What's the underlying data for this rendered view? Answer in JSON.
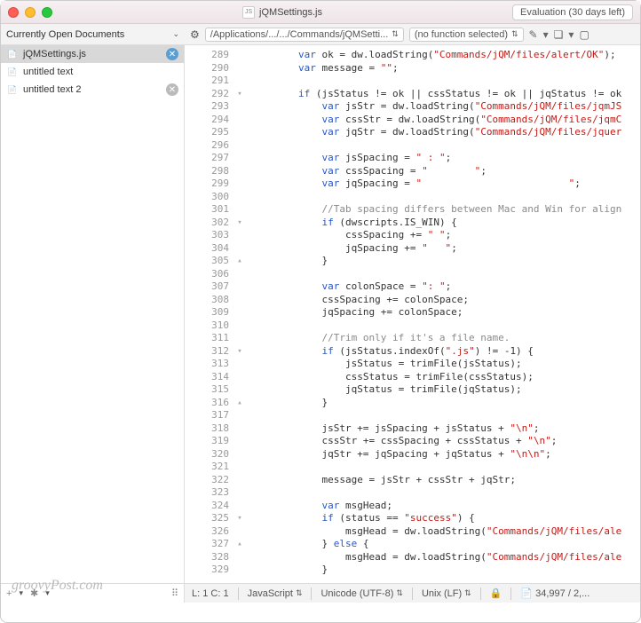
{
  "titlebar": {
    "filename": "jQMSettings.js",
    "eval": "Evaluation (30 days left)"
  },
  "filesHeader": "Currently Open Documents",
  "files": [
    {
      "name": "jQMSettings.js",
      "selected": true,
      "closeStyle": "blue"
    },
    {
      "name": "untitled text",
      "selected": false,
      "closeStyle": "none"
    },
    {
      "name": "untitled text 2",
      "selected": false,
      "closeStyle": "grey"
    }
  ],
  "toolbar": {
    "path": "/Applications/.../.../Commands/jQMSetti...",
    "funcSel": "(no function selected)"
  },
  "watermark": "groovyPost.com",
  "status": {
    "pos": "L: 1 C: 1",
    "lang": "JavaScript",
    "enc": "Unicode (UTF-8)",
    "lineend": "Unix (LF)",
    "size": "34,997 / 2,..."
  },
  "lineStart": 289,
  "lineCount": 41,
  "folds": {
    "292": "▾",
    "302": "▾",
    "305": "▴",
    "312": "▾",
    "316": "▴",
    "325": "▾",
    "327": "▴"
  },
  "code": [
    {
      "i": "        ",
      "t": [
        [
          "kw",
          "var"
        ],
        [
          "",
          " ok = dw.loadString("
        ],
        [
          "str",
          "\"Commands/jQM/files/alert/OK\""
        ],
        [
          "",
          ");"
        ]
      ]
    },
    {
      "i": "        ",
      "t": [
        [
          "kw",
          "var"
        ],
        [
          "",
          " message = "
        ],
        [
          "str",
          "\"\""
        ],
        [
          "",
          ";"
        ]
      ]
    },
    {
      "i": "        ",
      "t": [
        [
          "",
          ""
        ]
      ]
    },
    {
      "i": "        ",
      "t": [
        [
          "kw",
          "if"
        ],
        [
          "",
          " (jsStatus != ok || cssStatus != ok || jqStatus != ok"
        ]
      ]
    },
    {
      "i": "            ",
      "t": [
        [
          "kw",
          "var"
        ],
        [
          "",
          " jsStr = dw.loadString("
        ],
        [
          "str",
          "\"Commands/jQM/files/jqmJS"
        ]
      ]
    },
    {
      "i": "            ",
      "t": [
        [
          "kw",
          "var"
        ],
        [
          "",
          " cssStr = dw.loadString("
        ],
        [
          "str",
          "\"Commands/jQM/files/jqmC"
        ]
      ]
    },
    {
      "i": "            ",
      "t": [
        [
          "kw",
          "var"
        ],
        [
          "",
          " jqStr = dw.loadString("
        ],
        [
          "str",
          "\"Commands/jQM/files/jquer"
        ]
      ]
    },
    {
      "i": "            ",
      "t": [
        [
          "",
          ""
        ]
      ]
    },
    {
      "i": "            ",
      "t": [
        [
          "kw",
          "var"
        ],
        [
          "",
          " jsSpacing = "
        ],
        [
          "str",
          "\" : \""
        ],
        [
          "",
          ";"
        ]
      ]
    },
    {
      "i": "            ",
      "t": [
        [
          "kw",
          "var"
        ],
        [
          "",
          " cssSpacing = "
        ],
        [
          "str",
          "\"        \""
        ],
        [
          "",
          ";"
        ]
      ]
    },
    {
      "i": "            ",
      "t": [
        [
          "kw",
          "var"
        ],
        [
          "",
          " jqSpacing = "
        ],
        [
          "str",
          "\"                         \""
        ],
        [
          "",
          ";"
        ]
      ]
    },
    {
      "i": "            ",
      "t": [
        [
          "",
          ""
        ]
      ]
    },
    {
      "i": "            ",
      "t": [
        [
          "cm",
          "//Tab spacing differs between Mac and Win for align"
        ]
      ]
    },
    {
      "i": "            ",
      "t": [
        [
          "kw",
          "if"
        ],
        [
          "",
          " (dwscripts.IS_WIN) {"
        ]
      ]
    },
    {
      "i": "                ",
      "t": [
        [
          "",
          "cssSpacing += "
        ],
        [
          "str",
          "\" \""
        ],
        [
          "",
          ";"
        ]
      ]
    },
    {
      "i": "                ",
      "t": [
        [
          "",
          "jqSpacing += "
        ],
        [
          "str",
          "\"   \""
        ],
        [
          "",
          ";"
        ]
      ]
    },
    {
      "i": "            ",
      "t": [
        [
          "",
          "}"
        ]
      ]
    },
    {
      "i": "            ",
      "t": [
        [
          "",
          ""
        ]
      ]
    },
    {
      "i": "            ",
      "t": [
        [
          "kw",
          "var"
        ],
        [
          "",
          " colonSpace = "
        ],
        [
          "str",
          "\": \""
        ],
        [
          "",
          ";"
        ]
      ]
    },
    {
      "i": "            ",
      "t": [
        [
          "",
          "cssSpacing += colonSpace;"
        ]
      ]
    },
    {
      "i": "            ",
      "t": [
        [
          "",
          "jqSpacing += colonSpace;"
        ]
      ]
    },
    {
      "i": "            ",
      "t": [
        [
          "",
          ""
        ]
      ]
    },
    {
      "i": "            ",
      "t": [
        [
          "cm",
          "//Trim only if it's a file name."
        ]
      ]
    },
    {
      "i": "            ",
      "t": [
        [
          "kw",
          "if"
        ],
        [
          "",
          " (jsStatus.indexOf("
        ],
        [
          "str",
          "\".js\""
        ],
        [
          "",
          ") != -1) {"
        ]
      ]
    },
    {
      "i": "                ",
      "t": [
        [
          "",
          "jsStatus = trimFile(jsStatus);"
        ]
      ]
    },
    {
      "i": "                ",
      "t": [
        [
          "",
          "cssStatus = trimFile(cssStatus);"
        ]
      ]
    },
    {
      "i": "                ",
      "t": [
        [
          "",
          "jqStatus = trimFile(jqStatus);"
        ]
      ]
    },
    {
      "i": "            ",
      "t": [
        [
          "",
          "}"
        ]
      ]
    },
    {
      "i": "            ",
      "t": [
        [
          "",
          ""
        ]
      ]
    },
    {
      "i": "            ",
      "t": [
        [
          "",
          "jsStr += jsSpacing + jsStatus + "
        ],
        [
          "str",
          "\"\\n\""
        ],
        [
          "",
          ";"
        ]
      ]
    },
    {
      "i": "            ",
      "t": [
        [
          "",
          "cssStr += cssSpacing + cssStatus + "
        ],
        [
          "str",
          "\"\\n\""
        ],
        [
          "",
          ";"
        ]
      ]
    },
    {
      "i": "            ",
      "t": [
        [
          "",
          "jqStr += jqSpacing + jqStatus + "
        ],
        [
          "str",
          "\"\\n\\n\""
        ],
        [
          "",
          ";"
        ]
      ]
    },
    {
      "i": "            ",
      "t": [
        [
          "",
          ""
        ]
      ]
    },
    {
      "i": "            ",
      "t": [
        [
          "",
          "message = jsStr + cssStr + jqStr;"
        ]
      ]
    },
    {
      "i": "            ",
      "t": [
        [
          "",
          ""
        ]
      ]
    },
    {
      "i": "            ",
      "t": [
        [
          "kw",
          "var"
        ],
        [
          "",
          " msgHead;"
        ]
      ]
    },
    {
      "i": "            ",
      "t": [
        [
          "kw",
          "if"
        ],
        [
          "",
          " (status == "
        ],
        [
          "str",
          "\"success\""
        ],
        [
          "",
          ") {"
        ]
      ]
    },
    {
      "i": "                ",
      "t": [
        [
          "",
          "msgHead = dw.loadString("
        ],
        [
          "str",
          "\"Commands/jQM/files/ale"
        ]
      ]
    },
    {
      "i": "            ",
      "t": [
        [
          "",
          "} "
        ],
        [
          "kw",
          "else"
        ],
        [
          "",
          " {"
        ]
      ]
    },
    {
      "i": "                ",
      "t": [
        [
          "",
          "msgHead = dw.loadString("
        ],
        [
          "str",
          "\"Commands/jQM/files/ale"
        ]
      ]
    },
    {
      "i": "            ",
      "t": [
        [
          "",
          "}"
        ]
      ]
    }
  ]
}
